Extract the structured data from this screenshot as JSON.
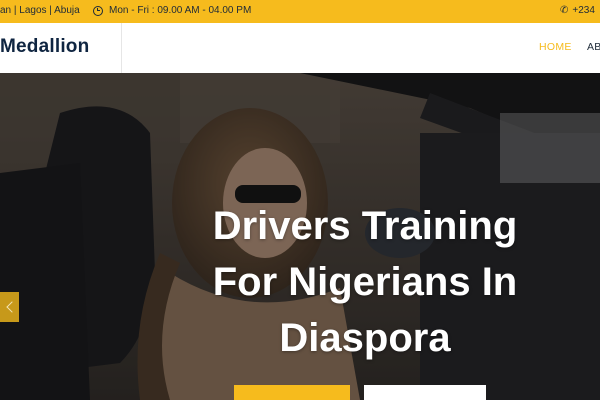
{
  "topbar": {
    "locations": "an | Lagos | Abuja",
    "hours": "Mon - Fri : 09.00 AM - 04.00 PM",
    "phone": "+234"
  },
  "header": {
    "brand": "Medallion",
    "nav": {
      "home": "HOME",
      "about": "AB"
    }
  },
  "hero": {
    "title_line1": "Drivers Training",
    "title_line2": "For Nigerians In",
    "title_line3": "Diaspora"
  },
  "colors": {
    "accent": "#f6bb1d",
    "brand_navy": "#0f2541",
    "text_dark": "#1e2a38"
  },
  "icons": {
    "hours": "clock-icon",
    "phone": "phone-icon",
    "slider_prev": "chevron-left-icon"
  }
}
